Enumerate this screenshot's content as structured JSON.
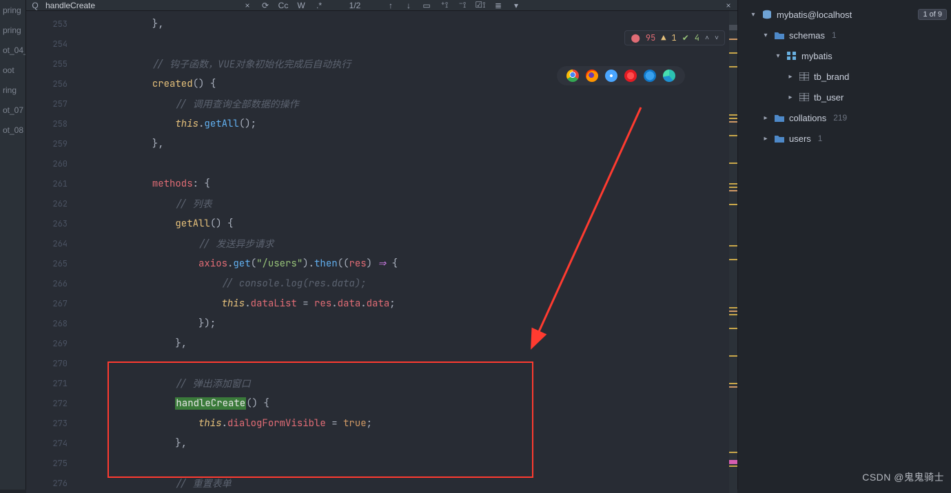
{
  "find": {
    "value": "handleCreate",
    "cc": "Cc",
    "word": "W",
    "regex": ".*",
    "count": "1/2",
    "close_x": "×"
  },
  "warnings": {
    "errors": "95",
    "warns": "1",
    "oks": "4"
  },
  "projects": [
    "pring",
    "pring",
    "ot_04_",
    "oot",
    "ring",
    "ot_07",
    "ot_08"
  ],
  "gutter": {
    "start": 253,
    "end": 276
  },
  "code_lines": [
    [
      {
        "cls": "c-pn",
        "t": "            },"
      }
    ],
    [],
    [
      {
        "cls": "c-pn",
        "t": "            "
      },
      {
        "cls": "c-cm",
        "t": "// 钩子函数，VUE对象初始化完成后自动执行"
      }
    ],
    [
      {
        "cls": "c-pn",
        "t": "            "
      },
      {
        "cls": "c-fn",
        "t": "created"
      },
      {
        "cls": "c-pn",
        "t": "() {"
      }
    ],
    [
      {
        "cls": "c-pn",
        "t": "                "
      },
      {
        "cls": "c-cm",
        "t": "// 调用查询全部数据的操作"
      }
    ],
    [
      {
        "cls": "c-pn",
        "t": "                "
      },
      {
        "cls": "c-th",
        "t": "this"
      },
      {
        "cls": "c-pn",
        "t": "."
      },
      {
        "cls": "c-fn2",
        "t": "getAll"
      },
      {
        "cls": "c-pn",
        "t": "();"
      }
    ],
    [
      {
        "cls": "c-pn",
        "t": "            },"
      }
    ],
    [],
    [
      {
        "cls": "c-pn",
        "t": "            "
      },
      {
        "cls": "c-pr",
        "t": "methods"
      },
      {
        "cls": "c-pn",
        "t": ": {"
      }
    ],
    [
      {
        "cls": "c-pn",
        "t": "                "
      },
      {
        "cls": "c-cm",
        "t": "// 列表"
      }
    ],
    [
      {
        "cls": "c-pn",
        "t": "                "
      },
      {
        "cls": "c-fn",
        "t": "getAll"
      },
      {
        "cls": "c-pn",
        "t": "() {"
      }
    ],
    [
      {
        "cls": "c-pn",
        "t": "                    "
      },
      {
        "cls": "c-cm",
        "t": "// 发送异步请求"
      }
    ],
    [
      {
        "cls": "c-pn",
        "t": "                    "
      },
      {
        "cls": "c-pr",
        "t": "axios"
      },
      {
        "cls": "c-pn",
        "t": "."
      },
      {
        "cls": "c-fn2",
        "t": "get"
      },
      {
        "cls": "c-pn",
        "t": "("
      },
      {
        "cls": "c-st",
        "t": "\"/users\""
      },
      {
        "cls": "c-pn",
        "t": ")."
      },
      {
        "cls": "c-fn2",
        "t": "then"
      },
      {
        "cls": "c-pn",
        "t": "(("
      },
      {
        "cls": "c-pr",
        "t": "res"
      },
      {
        "cls": "c-pn",
        "t": ") "
      },
      {
        "cls": "c-kw",
        "t": "⇒"
      },
      {
        "cls": "c-pn",
        "t": " {"
      }
    ],
    [
      {
        "cls": "c-pn",
        "t": "                        "
      },
      {
        "cls": "c-cm",
        "t": "// console.log(res.data);"
      }
    ],
    [
      {
        "cls": "c-pn",
        "t": "                        "
      },
      {
        "cls": "c-th",
        "t": "this"
      },
      {
        "cls": "c-pn",
        "t": "."
      },
      {
        "cls": "c-pr",
        "t": "dataList"
      },
      {
        "cls": "c-pn",
        "t": " = "
      },
      {
        "cls": "c-pr",
        "t": "res"
      },
      {
        "cls": "c-pn",
        "t": "."
      },
      {
        "cls": "c-pr",
        "t": "data"
      },
      {
        "cls": "c-pn",
        "t": "."
      },
      {
        "cls": "c-pr",
        "t": "data"
      },
      {
        "cls": "c-pn",
        "t": ";"
      }
    ],
    [
      {
        "cls": "c-pn",
        "t": "                    });"
      }
    ],
    [
      {
        "cls": "c-pn",
        "t": "                },"
      }
    ],
    [],
    [
      {
        "cls": "c-pn",
        "t": "                "
      },
      {
        "cls": "c-cm",
        "t": "// 弹出添加窗口"
      }
    ],
    [
      {
        "cls": "c-pn",
        "t": "                "
      },
      {
        "cls": "c-hl",
        "t": "handleCreate"
      },
      {
        "cls": "c-pn",
        "t": "() {"
      }
    ],
    [
      {
        "cls": "c-pn",
        "t": "                    "
      },
      {
        "cls": "c-th",
        "t": "this"
      },
      {
        "cls": "c-pn",
        "t": "."
      },
      {
        "cls": "c-pr",
        "t": "dialogFormVisible"
      },
      {
        "cls": "c-pn",
        "t": " = "
      },
      {
        "cls": "c-bool",
        "t": "true"
      },
      {
        "cls": "c-pn",
        "t": ";"
      }
    ],
    [
      {
        "cls": "c-pn",
        "t": "                },"
      }
    ],
    [],
    [
      {
        "cls": "c-pn",
        "t": "                "
      },
      {
        "cls": "c-cm",
        "t": "// 重置表单"
      }
    ]
  ],
  "db": {
    "root": {
      "label": "mybatis@localhost",
      "badge": "1 of 9"
    },
    "schemas": {
      "label": "schemas",
      "count": "1"
    },
    "schema_name": "mybatis",
    "tables": [
      "tb_brand",
      "tb_user"
    ],
    "collations": {
      "label": "collations",
      "count": "219"
    },
    "users": {
      "label": "users",
      "count": "1"
    }
  },
  "watermark": "CSDN @鬼鬼骑士"
}
